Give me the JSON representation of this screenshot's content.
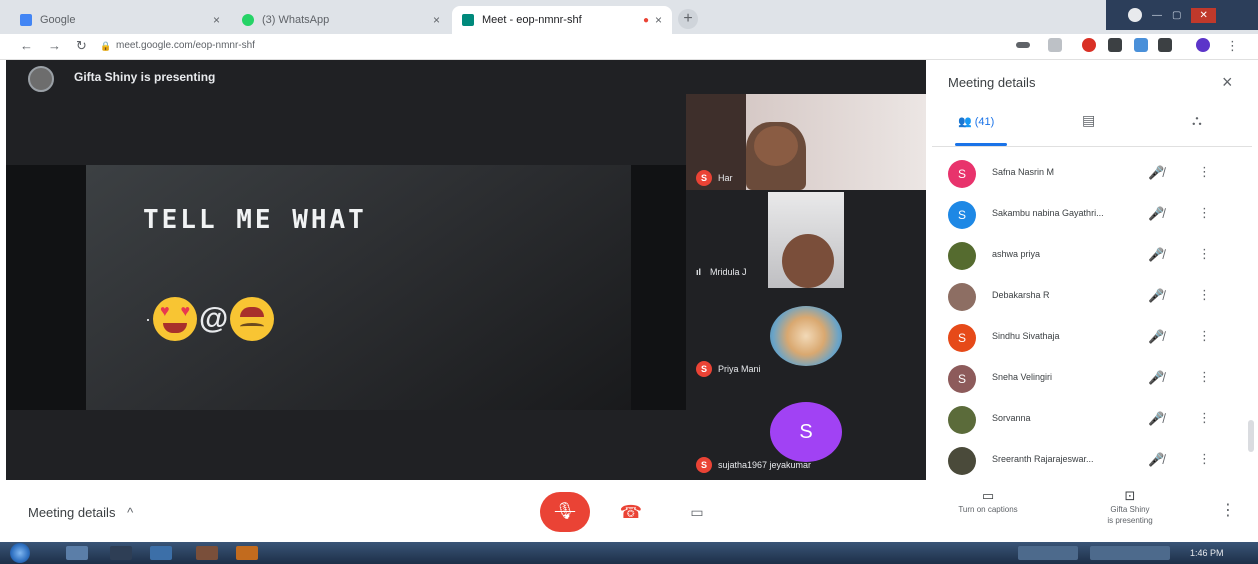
{
  "browser": {
    "tabs": [
      {
        "label": "Google",
        "favicon_color": "#4285f4",
        "close": "×"
      },
      {
        "label": "(3) WhatsApp",
        "favicon_color": "#25d366",
        "close": "×"
      },
      {
        "label": "Meet - eop-nmnr-shf",
        "favicon_color": "#00897b",
        "close": "×"
      }
    ],
    "new_tab": "+",
    "url": "meet.google.com/eop-nmnr-shf",
    "nav": {
      "back": "←",
      "forward": "→",
      "reload": "↻",
      "lock": "🔒"
    }
  },
  "stage": {
    "presenter_label": "Gifta Shiny is presenting",
    "slide_title": "TELL ME WHAT",
    "slide_emoji_at": "@"
  },
  "tiles": [
    {
      "name": "Har",
      "muted_badge": "S"
    },
    {
      "name": "Mridula J",
      "audio_icon": "ıl"
    },
    {
      "name": "Priya Mani",
      "muted_badge": "S"
    },
    {
      "name": "sujatha1967 jeyakumar",
      "avatar_letter": "S",
      "muted_badge": "S"
    }
  ],
  "panel": {
    "title": "Meeting details",
    "close": "×",
    "tabs": [
      {
        "icon": "people-icon",
        "label": "(41)"
      },
      {
        "icon": "chat-icon",
        "label": "▤"
      },
      {
        "icon": "activities-icon",
        "label": "⛬"
      }
    ],
    "participants": [
      {
        "name": "Safna Nasrin M",
        "initial": "S",
        "color": "#e8336c"
      },
      {
        "name": "Sakambu nabina Gayathri...",
        "initial": "S",
        "color": "#1e88e5"
      },
      {
        "name": "ashwa priya",
        "initial": "",
        "color": "#556b2f"
      },
      {
        "name": "Debakarsha R",
        "initial": "",
        "color": "#8d6e63"
      },
      {
        "name": "Sindhu Sivathaja",
        "initial": "S",
        "color": "#e64a19"
      },
      {
        "name": "Sneha Velingiri",
        "initial": "S",
        "color": "#8d5b5b"
      },
      {
        "name": "Sorvanna",
        "initial": "",
        "color": "#5b6b3a"
      },
      {
        "name": "Sreeranth Rajarajeswar...",
        "initial": "",
        "color": "#4a4a3a"
      }
    ],
    "mic_icon": "🎤̸",
    "more_icon": "⋮"
  },
  "controls": {
    "meeting_details": "Meeting details",
    "meeting_details_chevron": "^",
    "mic": "🎙",
    "hangup": "☎",
    "camera": "▭",
    "captions_label": "Turn on captions",
    "presenting_label_1": "Gifta Shiny",
    "presenting_label_2": "is presenting",
    "more": "⋮"
  },
  "taskbar": {
    "clock": "1:46 PM"
  },
  "colors": {
    "meet_red": "#ea4335",
    "stage_bg": "#202124",
    "accent_blue": "#1a73e8"
  }
}
